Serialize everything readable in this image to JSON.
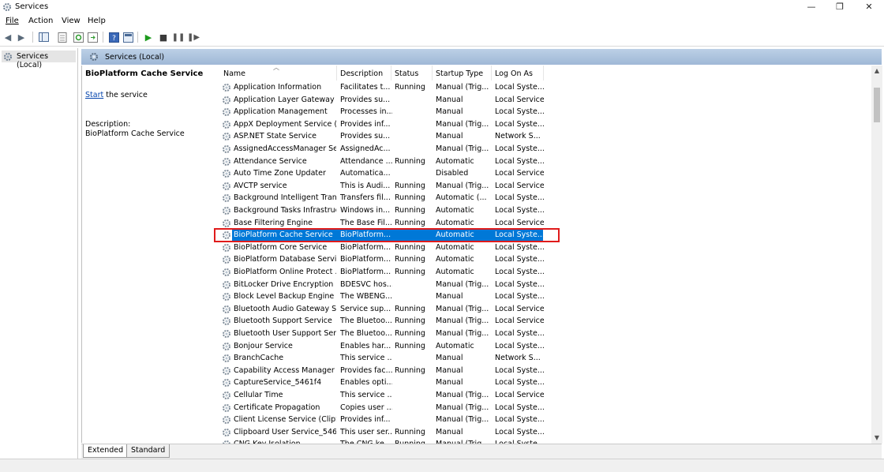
{
  "window": {
    "title": "Services",
    "minimize": "—",
    "maximize": "❐",
    "close": "✕"
  },
  "menu": [
    "File",
    "Action",
    "View",
    "Help"
  ],
  "tree": {
    "root": "Services (Local)"
  },
  "main": {
    "header": "Services (Local)",
    "selected_service_title": "BioPlatform Cache Service",
    "start_link": "Start",
    "start_suffix": " the service",
    "description_label": "Description:",
    "description_text": "BioPlatform Cache Service"
  },
  "table": {
    "columns": [
      "Name",
      "Description",
      "Status",
      "Startup Type",
      "Log On As"
    ],
    "rows": [
      [
        "Application Information",
        "Facilitates t...",
        "Running",
        "Manual (Trig...",
        "Local Syste..."
      ],
      [
        "Application Layer Gateway ...",
        "Provides su...",
        "",
        "Manual",
        "Local Service"
      ],
      [
        "Application Management",
        "Processes in...",
        "",
        "Manual",
        "Local Syste..."
      ],
      [
        "AppX Deployment Service (...",
        "Provides inf...",
        "",
        "Manual (Trig...",
        "Local Syste..."
      ],
      [
        "ASP.NET State Service",
        "Provides su...",
        "",
        "Manual",
        "Network S..."
      ],
      [
        "AssignedAccessManager Se...",
        "AssignedAc...",
        "",
        "Manual (Trig...",
        "Local Syste..."
      ],
      [
        "Attendance Service",
        "Attendance ...",
        "Running",
        "Automatic",
        "Local Syste..."
      ],
      [
        "Auto Time Zone Updater",
        "Automatica...",
        "",
        "Disabled",
        "Local Service"
      ],
      [
        "AVCTP service",
        "This is Audi...",
        "Running",
        "Manual (Trig...",
        "Local Service"
      ],
      [
        "Background Intelligent Tran...",
        "Transfers fil...",
        "Running",
        "Automatic (...",
        "Local Syste..."
      ],
      [
        "Background Tasks Infrastruc...",
        "Windows in...",
        "Running",
        "Automatic",
        "Local Syste..."
      ],
      [
        "Base Filtering Engine",
        "The Base Fil...",
        "Running",
        "Automatic",
        "Local Service"
      ],
      [
        "BioPlatform Cache Service",
        "BioPlatform...",
        "",
        "Automatic",
        "Local Syste..."
      ],
      [
        "BioPlatform Core Service",
        "BioPlatform...",
        "Running",
        "Automatic",
        "Local Syste..."
      ],
      [
        "BioPlatform Database Service",
        "BioPlatform...",
        "Running",
        "Automatic",
        "Local Syste..."
      ],
      [
        "BioPlatform Online Protect ...",
        "BioPlatform...",
        "Running",
        "Automatic",
        "Local Syste..."
      ],
      [
        "BitLocker Drive Encryption ...",
        "BDESVC hos...",
        "",
        "Manual (Trig...",
        "Local Syste..."
      ],
      [
        "Block Level Backup Engine ...",
        "The WBENG...",
        "",
        "Manual",
        "Local Syste..."
      ],
      [
        "Bluetooth Audio Gateway S...",
        "Service sup...",
        "Running",
        "Manual (Trig...",
        "Local Service"
      ],
      [
        "Bluetooth Support Service",
        "The Bluetoo...",
        "Running",
        "Manual (Trig...",
        "Local Service"
      ],
      [
        "Bluetooth User Support Ser...",
        "The Bluetoo...",
        "Running",
        "Manual (Trig...",
        "Local Syste..."
      ],
      [
        "Bonjour Service",
        "Enables har...",
        "Running",
        "Automatic",
        "Local Syste..."
      ],
      [
        "BranchCache",
        "This service ...",
        "",
        "Manual",
        "Network S..."
      ],
      [
        "Capability Access Manager ...",
        "Provides fac...",
        "Running",
        "Manual",
        "Local Syste..."
      ],
      [
        "CaptureService_5461f4",
        "Enables opti...",
        "",
        "Manual",
        "Local Syste..."
      ],
      [
        "Cellular Time",
        "This service ...",
        "",
        "Manual (Trig...",
        "Local Service"
      ],
      [
        "Certificate Propagation",
        "Copies user ...",
        "",
        "Manual (Trig...",
        "Local Syste..."
      ],
      [
        "Client License Service (ClipS...",
        "Provides inf...",
        "",
        "Manual (Trig...",
        "Local Syste..."
      ],
      [
        "Clipboard User Service_5461...",
        "This user ser...",
        "Running",
        "Manual",
        "Local Syste..."
      ],
      [
        "CNG Key Isolation",
        "The CNG ke...",
        "Running",
        "Manual (Trig...",
        "Local Syste..."
      ]
    ],
    "selected_row": 12
  },
  "tabs": [
    "Extended",
    "Standard"
  ],
  "colors": {
    "selection": "#0078d7",
    "highlight_box": "#e01b1b",
    "header_gradient": "#bcd0e6"
  }
}
